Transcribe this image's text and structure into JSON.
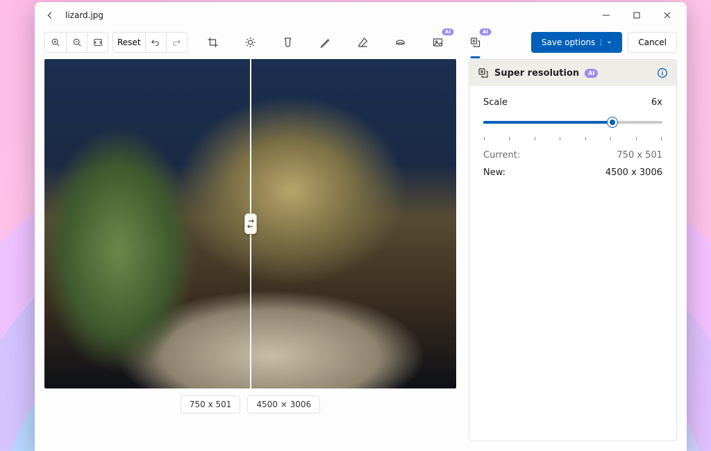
{
  "titlebar": {
    "filename": "lizard.jpg"
  },
  "toolbar": {
    "reset_label": "Reset",
    "save_label": "Save options",
    "cancel_label": "Cancel"
  },
  "tools": {
    "crop": "crop-icon",
    "adjust": "adjust-icon",
    "filter": "filter-icon",
    "markup": "markup-icon",
    "erase": "erase-icon",
    "retouch": "retouch-icon",
    "background": "background-ai-icon",
    "superres": "superres-ai-icon",
    "ai_badge": "AI"
  },
  "panel": {
    "title": "Super resolution",
    "scale_label": "Scale",
    "scale_value": "6x",
    "current_label": "Current:",
    "current_value": "750 x 501",
    "new_label": "New:",
    "new_value": "4500 x 3006",
    "slider_percent": 72
  },
  "compare": {
    "left_size": "750 x 501",
    "right_size": "4500 × 3006"
  }
}
